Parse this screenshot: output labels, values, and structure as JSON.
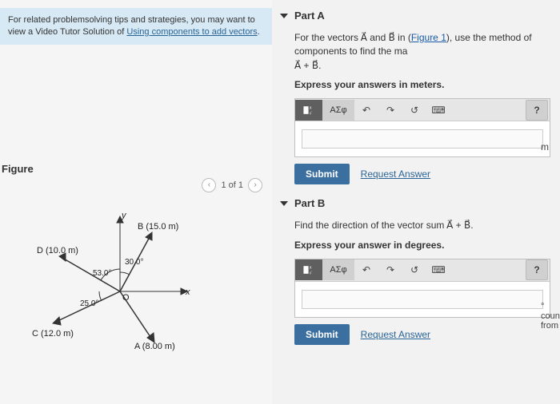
{
  "tip": {
    "prefix": "For related problemsolving tips and strategies, you may want to view a Video Tutor Solution of ",
    "link1": "Using components to add vectors",
    "suffix": "."
  },
  "figure": {
    "label": "Figure",
    "nav": "1 of 1",
    "vectors": {
      "B_label": "B (15.0 m)",
      "B_angle": "30.0°",
      "D_label": "D (10.0 m)",
      "D_angle": "53.0°",
      "C_label": "C (12.0 m)",
      "C_angle": "25.0°",
      "A_label": "A (8.00 m)",
      "y_axis": "y",
      "x_axis": "x",
      "origin": "O"
    }
  },
  "partA": {
    "title": "Part A",
    "q_prefix": "For the vectors A⃗ and B⃗ in (",
    "q_link": "Figure 1",
    "q_suffix": "), use the method of components to find the ma",
    "q_line2": "A⃗ + B⃗.",
    "instr": "Express your answers in meters.",
    "greek": "ΑΣφ",
    "help": "?",
    "unit": "m",
    "submit": "Submit",
    "request": "Request Answer"
  },
  "partB": {
    "title": "Part B",
    "q": "Find the  direction of the vector sum A⃗ + B⃗.",
    "instr": "Express your answer in degrees.",
    "greek": "ΑΣφ",
    "help": "?",
    "unit": "° counterclockwise from +x-axis",
    "submit": "Submit",
    "request": "Request Answer"
  }
}
